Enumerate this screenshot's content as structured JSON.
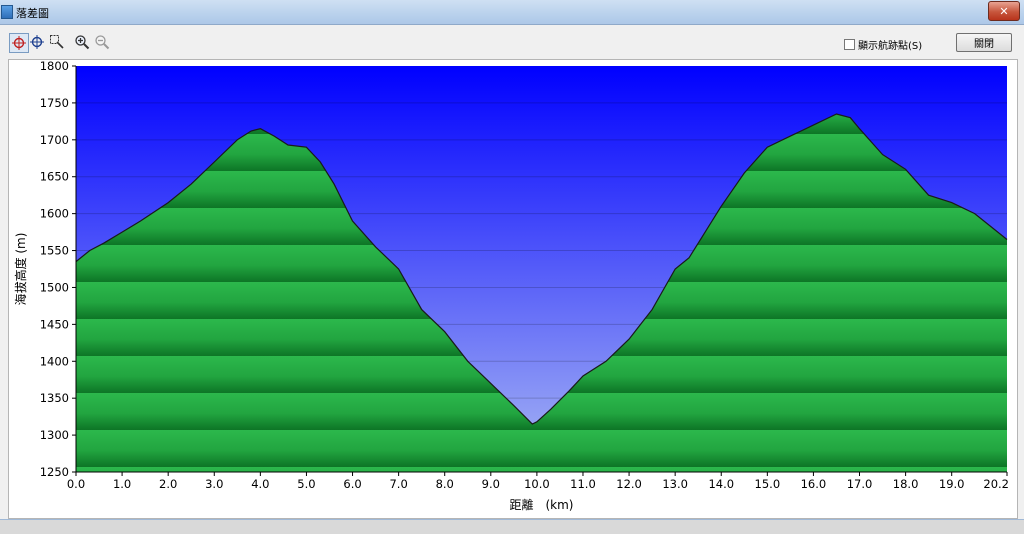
{
  "window": {
    "title": "落差圖",
    "close_glyph": "✕"
  },
  "toolbar": {
    "icons": [
      "crosshair-select-icon",
      "crosshair-icon",
      "zoom-area-icon",
      "zoom-in-icon",
      "zoom-out-icon"
    ],
    "show_points_label": "顯示航跡點(S)",
    "show_points_checked": false,
    "close_label": "關閉"
  },
  "colors": {
    "sky_top": "#0000ff",
    "sky_bottom": "#a9b8f3",
    "terrain_light": "#28b248",
    "terrain_dark": "#0f7a28",
    "outline": "#1a1a1a"
  },
  "chart_data": {
    "type": "area",
    "xlabel": "距離　(km)",
    "ylabel": "海拔高度 (m)",
    "xlim": [
      0,
      20.2
    ],
    "ylim": [
      1250,
      1800
    ],
    "x_ticks": [
      "0.0",
      "1.0",
      "2.0",
      "3.0",
      "4.0",
      "5.0",
      "6.0",
      "7.0",
      "8.0",
      "9.0",
      "10.0",
      "11.0",
      "12.0",
      "13.0",
      "14.0",
      "15.0",
      "16.0",
      "17.0",
      "18.0",
      "19.0",
      "20.2"
    ],
    "y_ticks": [
      "1800",
      "1750",
      "1700",
      "1650",
      "1600",
      "1550",
      "1500",
      "1450",
      "1400",
      "1350",
      "1300",
      "1250"
    ],
    "grid": true,
    "series": [
      {
        "x": [
          0.0,
          0.3,
          0.6,
          1.0,
          1.4,
          2.0,
          2.5,
          3.0,
          3.5,
          3.8,
          4.0,
          4.3,
          4.6,
          5.0,
          5.3,
          5.6,
          6.0,
          6.5,
          7.0,
          7.5,
          8.0,
          8.5,
          9.0,
          9.5,
          9.9,
          10.0,
          10.3,
          10.7,
          11.0,
          11.5,
          12.0,
          12.5,
          13.0,
          13.3,
          13.6,
          14.0,
          14.5,
          15.0,
          15.5,
          16.0,
          16.5,
          16.8,
          17.0,
          17.5,
          18.0,
          18.5,
          19.0,
          19.5,
          20.2
        ],
        "y": [
          1535,
          1550,
          1560,
          1575,
          1590,
          1615,
          1640,
          1670,
          1700,
          1712,
          1715,
          1705,
          1693,
          1690,
          1670,
          1640,
          1590,
          1555,
          1525,
          1470,
          1440,
          1400,
          1370,
          1340,
          1315,
          1318,
          1335,
          1360,
          1380,
          1400,
          1430,
          1470,
          1525,
          1540,
          1570,
          1610,
          1655,
          1690,
          1705,
          1720,
          1735,
          1730,
          1715,
          1680,
          1660,
          1625,
          1615,
          1600,
          1565
        ]
      }
    ]
  }
}
